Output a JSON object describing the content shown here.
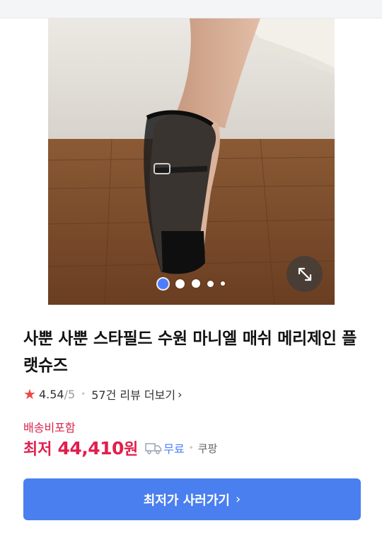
{
  "gallery": {
    "slide_count": 5,
    "active_slide": 1,
    "expand_icon": "expand-arrows-icon"
  },
  "product": {
    "title": "사뿐 사뿐 스타필드 수원 마니엘 매쉬 메리제인 플랫슈즈",
    "rating": {
      "score": "4.54",
      "max": "/5",
      "review_count_text": "57건 리뷰 더보기",
      "chevron": "›"
    },
    "shipping_label": "배송비포함",
    "price": {
      "prefix": "최저",
      "amount": "44,410",
      "unit": "원"
    },
    "delivery_badge": "무료",
    "mall": "쿠팡"
  },
  "cta": {
    "label": "최저가 사러가기",
    "arrow": "›"
  },
  "colors": {
    "accent_blue": "#4a7ff0",
    "price_red": "#e01f4c",
    "star_red": "#f04646"
  }
}
